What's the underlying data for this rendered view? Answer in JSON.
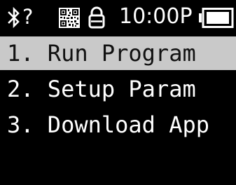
{
  "status_bar": {
    "bluetooth_icon": "bluetooth-icon",
    "unknown_indicator": "?",
    "qr_icon": "qr-code-icon",
    "lock_icon": "lock-icon",
    "time": "10:00P",
    "battery_icon": "battery-icon"
  },
  "menu": {
    "items": [
      {
        "label": "1. Run Program",
        "selected": true
      },
      {
        "label": "2. Setup Param",
        "selected": false
      },
      {
        "label": "3. Download App",
        "selected": false
      }
    ]
  },
  "colors": {
    "background": "#000000",
    "text": "#ffffff",
    "selection": "#c9c9c9",
    "selected_text": "#111111"
  }
}
